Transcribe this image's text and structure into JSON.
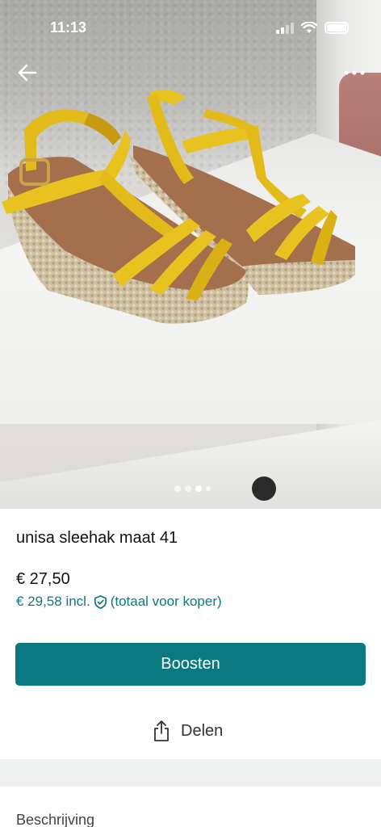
{
  "status_bar": {
    "time": "11:13"
  },
  "listing": {
    "title": "unisa sleehak maat 41",
    "price": "€ 27,50",
    "price_incl": "€ 29,58 incl.",
    "buyer_total_note": "(totaal voor koper)"
  },
  "actions": {
    "boost_label": "Boosten",
    "share_label": "Delen"
  },
  "sections": {
    "description_label": "Beschrijving"
  },
  "carousel": {
    "total": 4,
    "active_index": 3
  },
  "colors": {
    "accent": "#0b7a80",
    "accent_text": "#0b7a7e",
    "divider": "#eef0f0",
    "shoe_strap": "#e8c21e"
  },
  "icons": {
    "back": "back-arrow-icon",
    "more": "more-dots-icon",
    "shield": "shield-check-icon",
    "share": "share-icon",
    "wifi": "wifi-icon",
    "signal": "signal-icon",
    "battery": "battery-icon"
  }
}
